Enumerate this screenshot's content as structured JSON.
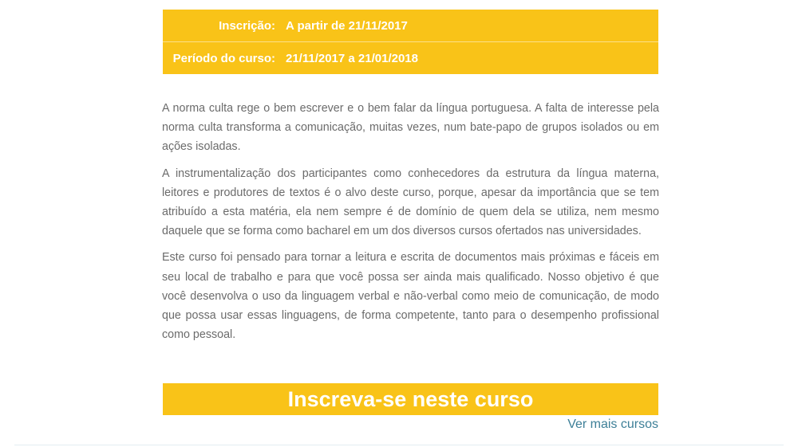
{
  "info": {
    "rows": [
      {
        "label": "Inscrição:",
        "value": "A partir de 21/11/2017"
      },
      {
        "label": "Período do curso:",
        "value": "21/11/2017 a 21/01/2018"
      }
    ]
  },
  "description": {
    "paragraphs": [
      "A norma culta rege o bem escrever e o bem falar da língua portuguesa. A falta de interesse pela norma culta transforma a comunicação, muitas vezes, num bate-papo de grupos isolados ou em ações isoladas.",
      "A instrumentalização dos participantes como conhecedores da estrutura da língua materna, leitores e produtores de textos é o alvo deste curso, porque, apesar da importância que se tem atribuído a esta matéria, ela nem sempre é de domínio de quem dela se utiliza, nem mesmo daquele que se forma como bacharel em um dos diversos cursos ofertados nas universidades.",
      "Este curso foi pensado para tornar a leitura e escrita de documentos mais próximas e fáceis em seu local de trabalho e para que você possa ser ainda mais qualificado. Nosso objetivo é que você desenvolva o uso da linguagem verbal e não-verbal como meio de comunicação, de modo que possa usar essas linguagens, de forma competente, tanto para o desempenho profissional como pessoal."
    ]
  },
  "actions": {
    "enroll_label": "Inscreva-se neste curso",
    "more_courses_label": "Ver mais cursos"
  },
  "colors": {
    "accent": "#f9c318",
    "body_text": "#6b6b6b",
    "link": "#3d7f97"
  }
}
